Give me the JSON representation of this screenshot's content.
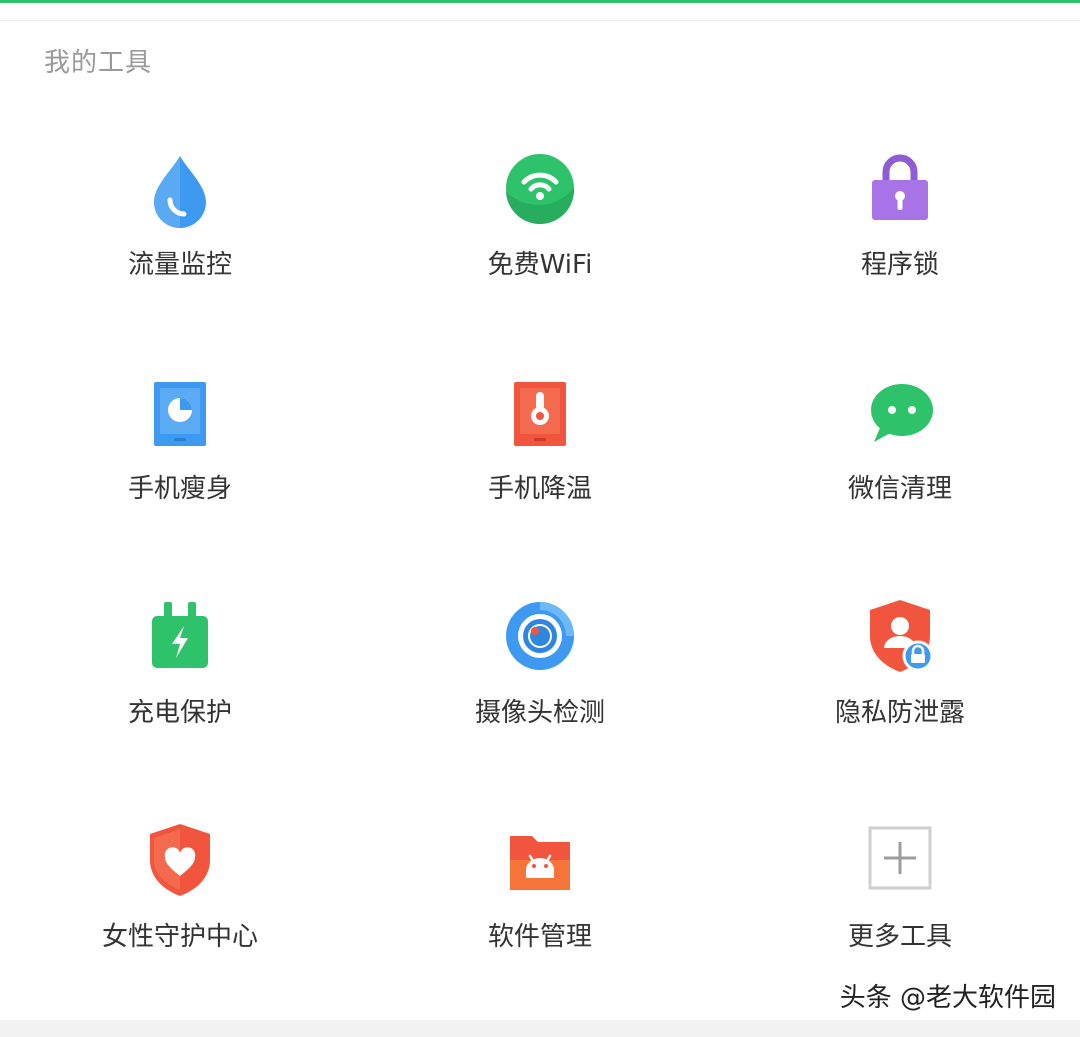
{
  "section": {
    "title": "我的工具"
  },
  "tools": [
    {
      "label": "流量监控",
      "icon": "water-drop-icon"
    },
    {
      "label": "免费WiFi",
      "icon": "wifi-icon"
    },
    {
      "label": "程序锁",
      "icon": "lock-icon"
    },
    {
      "label": "手机瘦身",
      "icon": "storage-pie-icon"
    },
    {
      "label": "手机降温",
      "icon": "thermometer-icon"
    },
    {
      "label": "微信清理",
      "icon": "wechat-icon"
    },
    {
      "label": "充电保护",
      "icon": "charger-icon"
    },
    {
      "label": "摄像头检测",
      "icon": "camera-lens-icon"
    },
    {
      "label": "隐私防泄露",
      "icon": "privacy-shield-icon"
    },
    {
      "label": "女性守护中心",
      "icon": "heart-shield-icon"
    },
    {
      "label": "软件管理",
      "icon": "android-folder-icon"
    },
    {
      "label": "更多工具",
      "icon": "plus-icon"
    }
  ],
  "watermark": "头条 @老大软件园",
  "colors": {
    "accent": "#2ec26a",
    "blue": "#3d9af0",
    "purple": "#a873e6",
    "red": "#f2553d",
    "green": "#2ec26a"
  }
}
